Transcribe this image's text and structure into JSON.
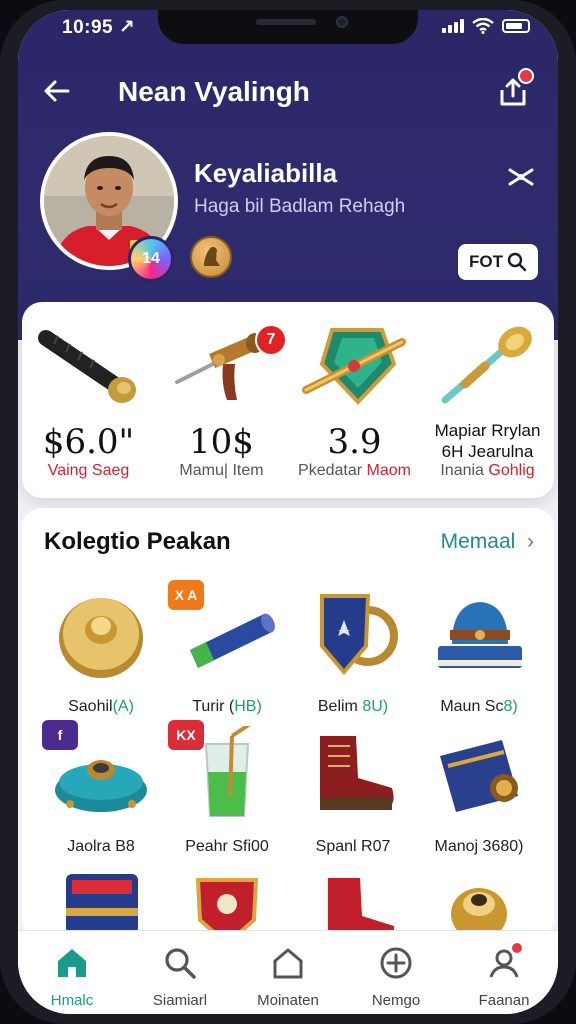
{
  "status": {
    "time": "10:95 ↗"
  },
  "topbar": {
    "title": "Nean Vyalingh"
  },
  "profile": {
    "name": "Keyaliabilla",
    "subtitle": "Haga bil Badlam Rehagh",
    "level_badge": "14",
    "follow_label": "FOT"
  },
  "stats": [
    {
      "value": "$6.0\"",
      "label_dark": "",
      "label_red": "Vaing Saeg",
      "art": "black-baton"
    },
    {
      "value": "10$",
      "label_dark": "Mamu| Item",
      "label_red": "",
      "badge": "7",
      "art": "brass-blowtorch"
    },
    {
      "value": "3.9",
      "label_dark": "Pkedatar ",
      "label_red": "Maom",
      "art": "emerald-shield-sword"
    },
    {
      "value": "Mapiar Rrylan\n6H Jearulna",
      "label_dark": "Inania ",
      "label_red": "Gohlig",
      "art": "golden-scepter"
    }
  ],
  "collection": {
    "title": "Kolegtio Peakan",
    "link": "Memaal",
    "items": [
      {
        "name": "Saohil",
        "code": "(A)",
        "art": "gold-button"
      },
      {
        "name": "Turir (",
        "code": "HB)",
        "art": "blue-battery",
        "tag": "X A",
        "tag_color": "#f07a1a"
      },
      {
        "name": "Belim ",
        "code": "8U)",
        "art": "blue-shield"
      },
      {
        "name": "Maun Sc",
        "code": "8)",
        "art": "blue-hat"
      },
      {
        "name": "Jaolra B8",
        "code": "",
        "art": "teal-lantern",
        "tag": "f",
        "tag_color": "#4b2b91"
      },
      {
        "name": "Peahr Sfi00",
        "code": "",
        "art": "green-drink",
        "tag": "KX",
        "tag_color": "#d92d3a"
      },
      {
        "name": "Spanl R07",
        "code": "",
        "art": "red-boot"
      },
      {
        "name": "Manoj 3680)",
        "code": "",
        "art": "blue-bag"
      },
      {
        "name": "",
        "code": "",
        "art": "blue-chest"
      },
      {
        "name": "",
        "code": "",
        "art": "red-crest"
      },
      {
        "name": "",
        "code": "",
        "art": "red-boot-2"
      },
      {
        "name": "",
        "code": "",
        "art": "gold-bell"
      }
    ]
  },
  "nav": [
    {
      "label": "Hmalc",
      "icon": "home-icon",
      "active": true
    },
    {
      "label": "Siamiarl",
      "icon": "search-icon",
      "active": false
    },
    {
      "label": "Moinaten",
      "icon": "house-outline-icon",
      "active": false
    },
    {
      "label": "Nemgo",
      "icon": "plus-circle-icon",
      "active": false
    },
    {
      "label": "Faanan",
      "icon": "profile-icon",
      "active": false
    }
  ],
  "colors": {
    "header": "#2b2766",
    "accent": "#1a9b8c",
    "badge_red": "#e02424"
  }
}
